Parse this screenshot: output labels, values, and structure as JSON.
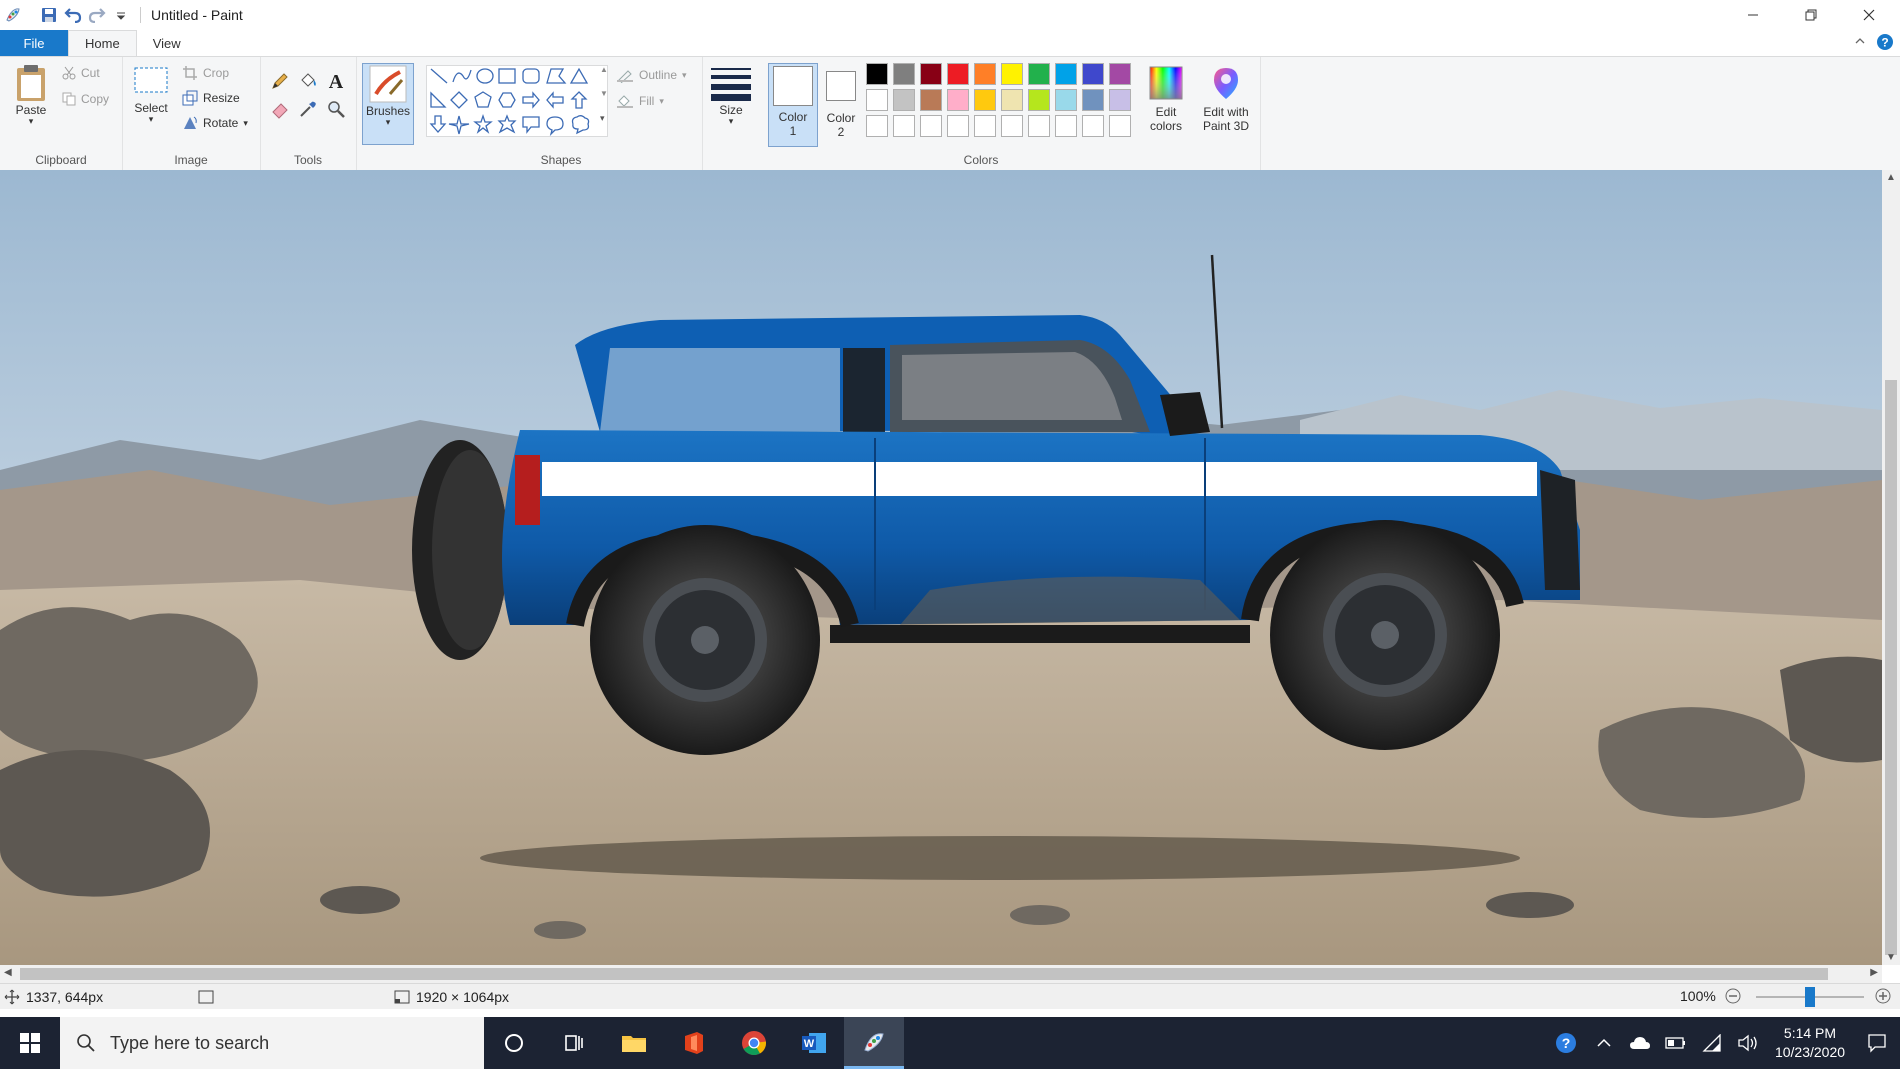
{
  "window": {
    "title": "Untitled - Paint"
  },
  "tabs": {
    "file": "File",
    "home": "Home",
    "view": "View"
  },
  "clipboard": {
    "paste": "Paste",
    "cut": "Cut",
    "copy": "Copy",
    "label": "Clipboard"
  },
  "image": {
    "select": "Select",
    "crop": "Crop",
    "resize": "Resize",
    "rotate": "Rotate",
    "label": "Image"
  },
  "tools": {
    "label": "Tools"
  },
  "brushes": {
    "label": "Brushes"
  },
  "shapes": {
    "outline": "Outline",
    "fill": "Fill",
    "label": "Shapes"
  },
  "size": {
    "label": "Size"
  },
  "color1": {
    "label1": "Color",
    "label2": "1"
  },
  "color2": {
    "label1": "Color",
    "label2": "2"
  },
  "colors": {
    "label": "Colors",
    "row1": [
      "#000000",
      "#7f7f7f",
      "#880015",
      "#ed1c24",
      "#ff7f27",
      "#fff200",
      "#22b14c",
      "#00a2e8",
      "#3f48cc",
      "#a349a4"
    ],
    "row2": [
      "#ffffff",
      "#c3c3c3",
      "#b97a57",
      "#ffaec9",
      "#ffc90e",
      "#efe4b0",
      "#b5e61d",
      "#99d9ea",
      "#7092be",
      "#c8bfe7"
    ],
    "row3": [
      "#ffffff",
      "#ffffff",
      "#ffffff",
      "#ffffff",
      "#ffffff",
      "#ffffff",
      "#ffffff",
      "#ffffff",
      "#ffffff",
      "#ffffff"
    ]
  },
  "edit_colors": {
    "line1": "Edit",
    "line2": "colors"
  },
  "paint3d": {
    "line1": "Edit with",
    "line2": "Paint 3D"
  },
  "status": {
    "cursor": "1337, 644px",
    "image_size": "1920 × 1064px",
    "zoom": "100%",
    "zoom_level": 0.5
  },
  "taskbar": {
    "search_placeholder": "Type here to search",
    "time": "5:14 PM",
    "date": "10/23/2020"
  }
}
